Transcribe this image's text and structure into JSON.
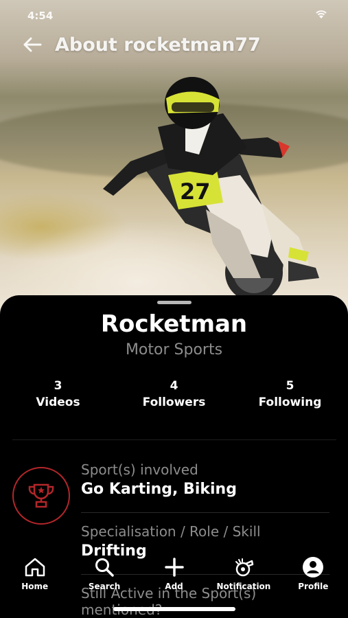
{
  "status_bar": {
    "time": "4:54",
    "icons": "wifi-icon"
  },
  "header": {
    "title": "About rocketman77"
  },
  "hero": {
    "jersey_number": "27"
  },
  "profile": {
    "name": "Rocketman",
    "category": "Motor Sports",
    "stats": [
      {
        "count": "3",
        "label": "Videos"
      },
      {
        "count": "4",
        "label": "Followers"
      },
      {
        "count": "5",
        "label": "Following"
      }
    ]
  },
  "details": [
    {
      "label": "Sport(s) involved",
      "value": "Go Karting, Biking"
    },
    {
      "label": "Specialisation / Role / Skill",
      "value": "Drifting"
    },
    {
      "label": "Still Active in the Sport(s) mentioned?",
      "value": ""
    }
  ],
  "nav": {
    "items": [
      {
        "label": "Home",
        "icon": "home-icon"
      },
      {
        "label": "Search",
        "icon": "search-icon"
      },
      {
        "label": "Add",
        "icon": "plus-icon"
      },
      {
        "label": "Notification",
        "icon": "whistle-icon"
      },
      {
        "label": "Profile",
        "icon": "person-icon"
      }
    ]
  },
  "colors": {
    "accent": "#b3262a",
    "muted_text": "#8d8d8d",
    "background": "#000000"
  }
}
